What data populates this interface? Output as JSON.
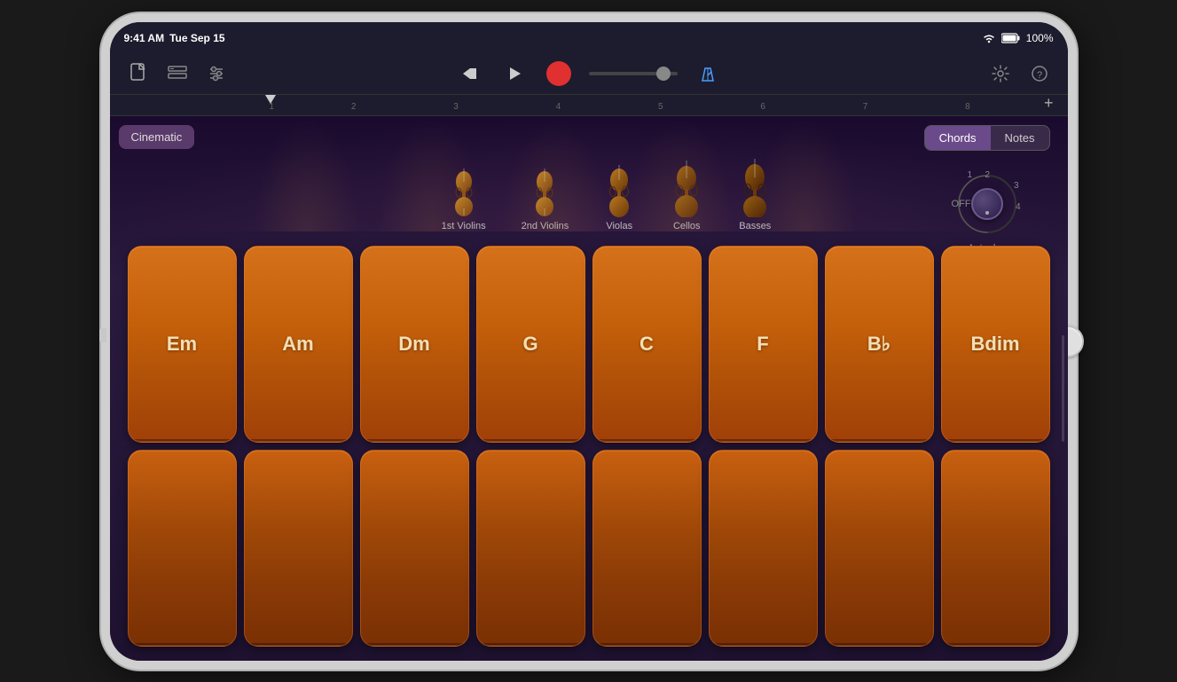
{
  "device": {
    "time": "9:41 AM",
    "date": "Tue Sep 15",
    "battery": "100%",
    "wifi": true
  },
  "toolbar": {
    "new_btn": "🎵",
    "tracks_btn": "⊞",
    "mixer_btn": "⚙",
    "rewind_btn": "⏮",
    "play_btn": "▶",
    "record_btn": "●",
    "settings_btn": "⚙",
    "help_btn": "?",
    "metronome_icon": "♩"
  },
  "ruler": {
    "marks": [
      "1",
      "2",
      "3",
      "4",
      "5",
      "6",
      "7",
      "8"
    ]
  },
  "content": {
    "instrument_name": "Cinematic",
    "instruments": [
      {
        "name": "1st Violins"
      },
      {
        "name": "2nd Violins"
      },
      {
        "name": "Violas"
      },
      {
        "name": "Cellos"
      },
      {
        "name": "Basses"
      }
    ],
    "chord_notes_toggle": {
      "chords_label": "Chords",
      "notes_label": "Notes",
      "active": "Chords"
    },
    "autoplay": {
      "label": "Autoplay",
      "off_label": "OFF",
      "positions": [
        "1",
        "2",
        "3",
        "4"
      ]
    },
    "chord_rows": [
      [
        {
          "label": "Em"
        },
        {
          "label": "Am"
        },
        {
          "label": "Dm"
        },
        {
          "label": "G"
        },
        {
          "label": "C"
        },
        {
          "label": "F"
        },
        {
          "label": "B♭"
        },
        {
          "label": "Bdim"
        }
      ],
      [
        {
          "label": ""
        },
        {
          "label": ""
        },
        {
          "label": ""
        },
        {
          "label": ""
        },
        {
          "label": ""
        },
        {
          "label": ""
        },
        {
          "label": ""
        },
        {
          "label": ""
        }
      ]
    ]
  }
}
